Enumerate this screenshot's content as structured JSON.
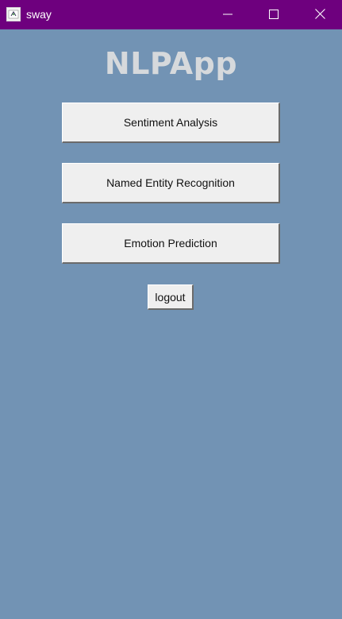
{
  "window": {
    "title": "sway",
    "titlebar_color": "#6e007e",
    "background_color": "#7293b4",
    "controls": {
      "minimize_icon": "minimize-icon",
      "maximize_icon": "maximize-icon",
      "close_icon": "close-icon"
    }
  },
  "app": {
    "title": "NLPApp",
    "title_color": "#d6d9dc"
  },
  "menu": {
    "buttons": [
      {
        "label": "Sentiment Analysis"
      },
      {
        "label": "Named Entity Recognition"
      },
      {
        "label": "Emotion Prediction"
      }
    ],
    "logout_label": "logout"
  }
}
